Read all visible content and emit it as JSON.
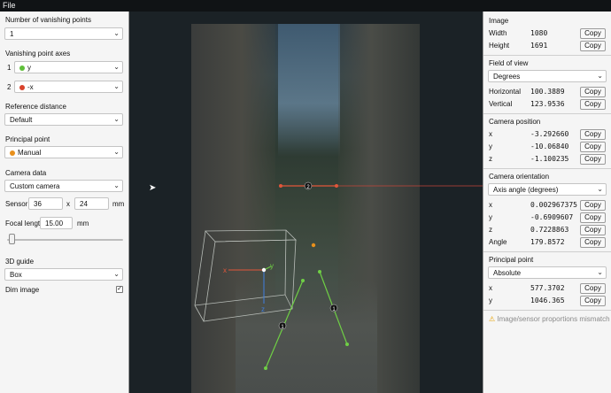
{
  "menu": {
    "file": "File"
  },
  "left": {
    "vp_count_label": "Number of vanishing points",
    "vp_count_value": "1",
    "axes_label": "Vanishing point axes",
    "axis1": {
      "index": "1",
      "value": "y",
      "color": "#5fbf3a"
    },
    "axis2": {
      "index": "2",
      "value": "-x",
      "color": "#d9432c"
    },
    "ref_label": "Reference distance",
    "ref_value": "Default",
    "pp_label": "Principal point",
    "pp_value": "Manual",
    "pp_color": "#e8901c",
    "camdata_label": "Camera data",
    "camdata_value": "Custom camera",
    "sensor_label": "Sensor",
    "sensor_w": "36",
    "sensor_x": "x",
    "sensor_h": "24",
    "sensor_unit": "mm",
    "focal_label": "Focal length",
    "focal_value": "15.00",
    "focal_unit": "mm",
    "focal_slider_fraction": 0.02,
    "guide_label": "3D guide",
    "guide_value": "Box",
    "dim_label": "Dim image",
    "dim_checked": "✓"
  },
  "right": {
    "image_title": "Image",
    "width_label": "Width",
    "width_value": "1080",
    "height_label": "Height",
    "height_value": "1691",
    "fov_title": "Field of view",
    "fov_unit": "Degrees",
    "horiz_label": "Horizontal",
    "horiz_value": "100.3889",
    "vert_label": "Vertical",
    "vert_value": "123.9536",
    "campos_title": "Camera position",
    "pos_x_label": "x",
    "pos_x": "-3.292660",
    "pos_y_label": "y",
    "pos_y": "-10.06840",
    "pos_z_label": "z",
    "pos_z": "-1.100235",
    "orient_title": "Camera orientation",
    "orient_mode": "Axis angle (degrees)",
    "or_x_label": "x",
    "or_x": "0.002967375",
    "or_y_label": "y",
    "or_y": "-0.6909607",
    "or_z_label": "z",
    "or_z": "0.7228863",
    "angle_label": "Angle",
    "angle": "179.8572",
    "pp_title": "Principal point",
    "pp_mode": "Absolute",
    "pp_x_label": "x",
    "pp_x": "577.3702",
    "pp_y_label": "y",
    "pp_y": "1046.365",
    "copy": "Copy",
    "warning": "Image/sensor proportions mismatch"
  },
  "viewport": {
    "handle1_label": "1",
    "handle2_label": "2",
    "axis_x_label": "x",
    "axis_y_label": "y",
    "axis_z_label": "z",
    "colors": {
      "green": "#6fcf45",
      "red": "#e2563a",
      "blue": "#3f7fe0",
      "orange": "#e8901c"
    }
  }
}
